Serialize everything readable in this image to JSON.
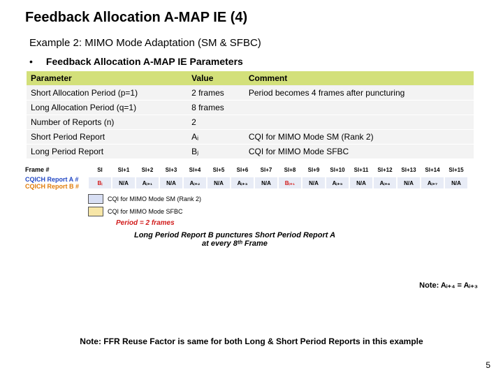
{
  "title": "Feedback Allocation A-MAP IE (4)",
  "example": "Example 2: MIMO Mode Adaptation (SM & SFBC)",
  "bullet": "Feedback Allocation A-MAP IE Parameters",
  "table": {
    "headers": {
      "p": "Parameter",
      "v": "Value",
      "c": "Comment"
    },
    "rows": [
      {
        "p": "Short Allocation Period (p=1)",
        "v": "2 frames",
        "c": "Period becomes 4 frames after puncturing"
      },
      {
        "p": "Long Allocation Period (q=1)",
        "v": "8 frames",
        "c": ""
      },
      {
        "p": "Number of Reports (n)",
        "v": "2",
        "c": ""
      },
      {
        "p": "Short Period Report",
        "v": "Aᵢ",
        "c": "CQI for MIMO Mode SM (Rank 2)"
      },
      {
        "p": "Long Period Report",
        "v": "Bⱼ",
        "c": "CQI for MIMO Mode SFBC"
      }
    ]
  },
  "diagram": {
    "frame_label": "Frame #",
    "frames": [
      "Sl",
      "Sl+1",
      "Sl+2",
      "Sl+3",
      "Sl+4",
      "Sl+5",
      "Sl+6",
      "Sl+7",
      "Sl+8",
      "Sl+9",
      "Sl+10",
      "Sl+11",
      "Sl+12",
      "Sl+13",
      "Sl+14",
      "Sl+15"
    ],
    "report_label_a": "CQICH Report A #",
    "report_label_b": "CQICH Report B #",
    "reports": [
      "Bᵢ",
      "N/A",
      "Aᵢ₊₁",
      "N/A",
      "Aᵢ₊₂",
      "N/A",
      "Aᵢ₊₃",
      "N/A",
      "Bᵢ₊₁",
      "N/A",
      "Aᵢ₊₅",
      "N/A",
      "Aᵢ₊₆",
      "N/A",
      "Aᵢ₊₇",
      "N/A"
    ],
    "punctured_cols": [
      0,
      8
    ],
    "legend_a": "CQI for MIMO Mode SM (Rank 2)",
    "legend_b": "CQI for MIMO Mode SFBC",
    "period_text": "Period = 2 frames",
    "arrow_text": "Long Period Report B punctures Short Period Report A at every 8ᵗʰ Frame",
    "right_note": "Note: Aᵢ₊₄ = Aᵢ₊₃"
  },
  "bottom_note": "Note: FFR Reuse Factor is same for both Long & Short Period Reports in this example",
  "page_number": "5"
}
